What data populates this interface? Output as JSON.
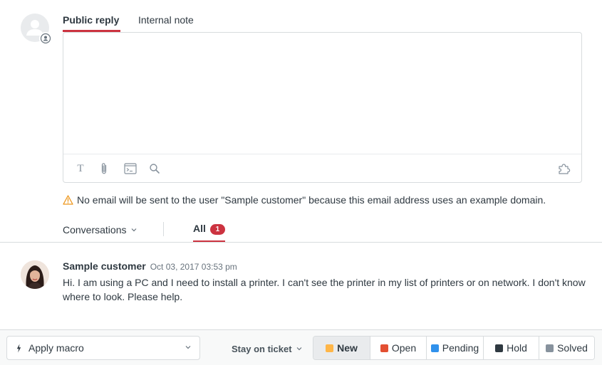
{
  "composer": {
    "tabs": [
      {
        "label": "Public reply",
        "active": true
      },
      {
        "label": "Internal note",
        "active": false
      }
    ],
    "body_value": "",
    "toolbar": {
      "text_format_glyph": "T",
      "icons": [
        "text-format-icon",
        "attachment-icon",
        "terminal-icon",
        "search-icon",
        "puzzle-icon"
      ]
    }
  },
  "warning": {
    "icon": "warning-triangle-icon",
    "icon_color": "#ed961c",
    "text": "No email will be sent to the user \"Sample customer\" because this email address uses an example domain."
  },
  "conversation_filters": {
    "channel_label": "Conversations",
    "all_label": "All",
    "all_count": "1",
    "accent_color": "#cc3340"
  },
  "message": {
    "author": "Sample customer",
    "timestamp": "Oct 03, 2017 03:53 pm",
    "body": "Hi. I am using a PC and I need to install a printer. I can't see the printer in my list of printers or on network. I don't know where to look. Please help."
  },
  "footer": {
    "macro_label": "Apply macro",
    "stay_label": "Stay on ticket",
    "statuses": [
      {
        "label": "New",
        "color": "#ffb648",
        "selected": true
      },
      {
        "label": "Open",
        "color": "#e34f32",
        "selected": false
      },
      {
        "label": "Pending",
        "color": "#3091ec",
        "selected": false
      },
      {
        "label": "Hold",
        "color": "#2f3941",
        "selected": false
      },
      {
        "label": "Solved",
        "color": "#87929d",
        "selected": false
      }
    ]
  }
}
